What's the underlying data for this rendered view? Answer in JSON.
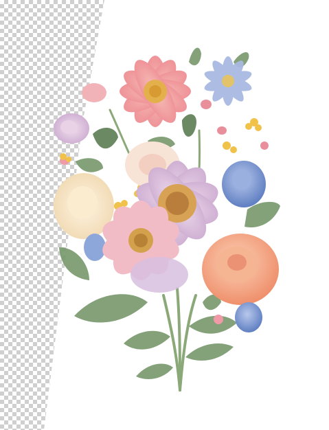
{
  "image": {
    "subject": "bouquet",
    "colors": {
      "checker_light": "#ffffff",
      "checker_dark": "#cfcfcf",
      "paper": "#ffffff",
      "leaf": "#7a9a6e",
      "leaf_dark": "#5f7f56",
      "stem": "#8aa878",
      "pink_daisy": "#f2a3a3",
      "daisy_center": "#e3b04b",
      "blue_aster": "#9fb3de",
      "blue_rose": "#7f9ad2",
      "peach_rose": "#f4a583",
      "lavender_flower": "#d9bfd9",
      "cream_flower": "#f6e3c4",
      "pale_pink_flower": "#f3c6cc",
      "yellow_buds": "#f0c24a"
    }
  }
}
